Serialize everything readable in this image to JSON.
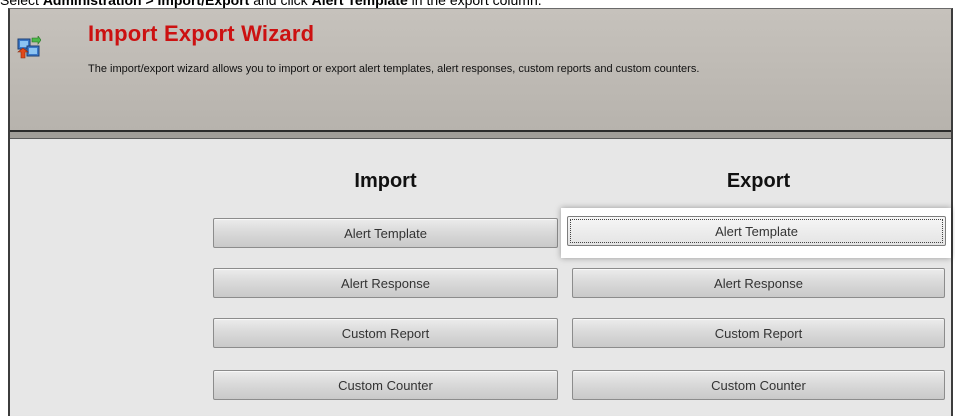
{
  "instruction": {
    "prefix": "Select ",
    "bold_path": "Administration > Import/Export",
    "middle": " and click ",
    "bold_target": "Alert Template",
    "suffix": " in the export column."
  },
  "header": {
    "icon": "import-export-icon",
    "title": "Import Export Wizard",
    "description": "The import/export wizard allows you to import or export alert templates, alert responses, custom reports and custom counters."
  },
  "import_column": {
    "heading": "Import",
    "buttons": [
      "Alert Template",
      "Alert Response",
      "Custom Report",
      "Custom Counter"
    ]
  },
  "export_column": {
    "heading": "Export",
    "buttons": [
      "Alert Template",
      "Alert Response",
      "Custom Report",
      "Custom Counter"
    ],
    "highlighted": "Alert Template"
  },
  "colors": {
    "title": "#cc1111",
    "header_background": "#bdb9b3",
    "content_background": "#e7e7e7",
    "highlight": "#ffffff"
  }
}
